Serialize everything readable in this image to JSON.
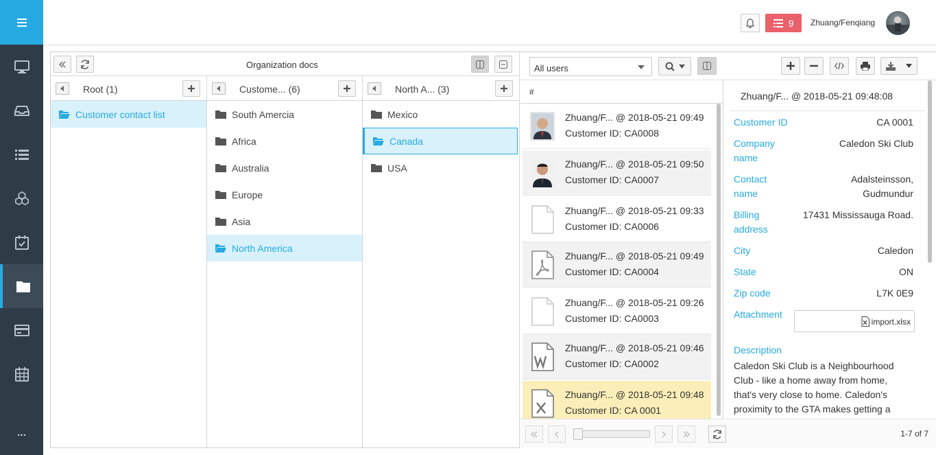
{
  "topbar": {
    "alert_count": "9",
    "user_name": "Zhuang/Fenqiang"
  },
  "sidebar": {
    "items": [
      {
        "icon": "monitor-icon"
      },
      {
        "icon": "inbox-icon"
      },
      {
        "icon": "list-icon"
      },
      {
        "icon": "cubes-icon"
      },
      {
        "icon": "calendar-check-icon"
      },
      {
        "icon": "folder-icon",
        "active": true
      },
      {
        "icon": "card-icon"
      },
      {
        "icon": "calendar-icon"
      }
    ],
    "more": "..."
  },
  "org": {
    "title": "Organization docs",
    "columns": [
      {
        "title": "Root (1)",
        "items": [
          "Customer contact list"
        ],
        "selected": 0
      },
      {
        "title": "Custome... (6)",
        "items": [
          "South Amercia",
          "Africa",
          "Australia",
          "Europe",
          "Asia",
          "North America"
        ],
        "selected": 5
      },
      {
        "title": "North A... (3)",
        "items": [
          "Mexico",
          "Canada",
          "USA"
        ],
        "selected": 1
      }
    ]
  },
  "filter": {
    "users": "All users"
  },
  "list": {
    "header": "#",
    "rows": [
      {
        "title": "Zhuang/F... @ 2018-05-21 09:49",
        "sub": "Customer ID: CA0008",
        "thumb": "photo"
      },
      {
        "title": "Zhuang/F... @ 2018-05-21 09:50",
        "sub": "Customer ID: CA0007",
        "thumb": "photo"
      },
      {
        "title": "Zhuang/F... @ 2018-05-21 09:33",
        "sub": "Customer ID: CA0006",
        "thumb": "file"
      },
      {
        "title": "Zhuang/F... @ 2018-05-21 09:49",
        "sub": "Customer ID: CA0004",
        "thumb": "pdf"
      },
      {
        "title": "Zhuang/F... @ 2018-05-21 09:26",
        "sub": "Customer ID: CA0003",
        "thumb": "file"
      },
      {
        "title": "Zhuang/F... @ 2018-05-21 09:46",
        "sub": "Customer ID: CA0002",
        "thumb": "word"
      },
      {
        "title": "Zhuang/F... @ 2018-05-21 09:48",
        "sub": "Customer ID: CA 0001",
        "thumb": "excel"
      }
    ]
  },
  "pager": {
    "count": "1-7 of 7"
  },
  "detail": {
    "title": "Zhuang/F... @ 2018-05-21 09:48:08",
    "fields": {
      "customer_id": {
        "label": "Customer ID",
        "value": "CA 0001"
      },
      "company_name": {
        "label1": "Company",
        "label2": "name",
        "value": "Caledon Ski Club"
      },
      "contact_name": {
        "label1": "Contact",
        "label2": "name",
        "value1": "Adalsteinsson,",
        "value2": "Gudmundur"
      },
      "billing_address": {
        "label1": "Billing",
        "label2": "address",
        "value": "17431 Mississauga Road."
      },
      "city": {
        "label": "City",
        "value": "Caledon"
      },
      "state": {
        "label": "State",
        "value": "ON"
      },
      "zip": {
        "label": "Zip code",
        "value": "L7K 0E9"
      },
      "attachment": {
        "label": "Attachment",
        "value": "import.xlsx"
      }
    },
    "description_label": "Description",
    "description": "Caledon Ski Club is a Neighbourhood Club - like a home away from home, that's very close to home.  Caledon's proximity to the GTA makes getting a"
  }
}
